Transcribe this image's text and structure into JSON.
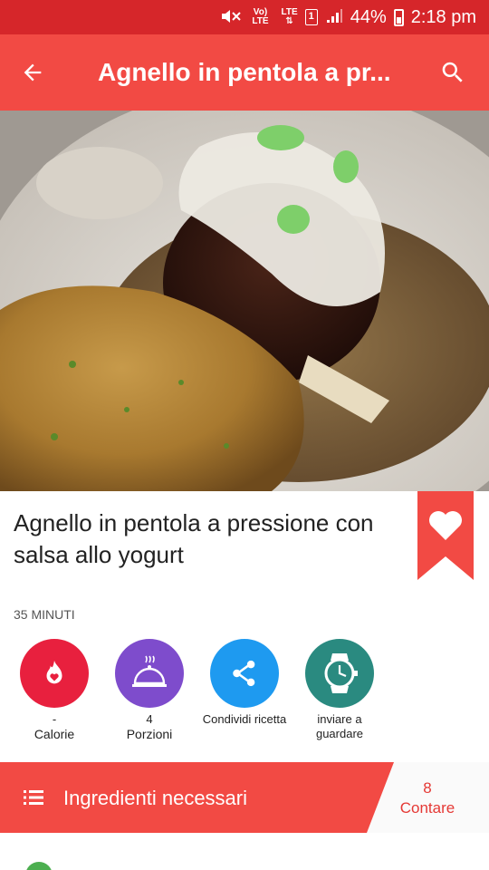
{
  "status_bar": {
    "volte": "Vo)",
    "lte_small": "LTE",
    "lte": "LTE",
    "sim": "1",
    "battery_text": "44%",
    "time": "2:18 pm"
  },
  "app_bar": {
    "title": "Agnello in pentola a pr...",
    "back_icon": "arrow-back-icon",
    "search_icon": "search-icon"
  },
  "recipe": {
    "title": "Agnello in pentola a pressione con salsa allo yogurt",
    "time": "35 MINUTI"
  },
  "actions": [
    {
      "value": "-",
      "label": "Calorie",
      "icon": "flame-heart-icon",
      "color": "#e8203e"
    },
    {
      "value": "4",
      "label": "Porzioni",
      "icon": "serving-dish-icon",
      "color": "#7e4ccc"
    },
    {
      "value": "",
      "label": "Condividi ricetta",
      "icon": "share-icon",
      "color": "#1e9af0"
    },
    {
      "value": "",
      "label": "inviare a guardare",
      "icon": "watch-icon",
      "color": "#2a8a80"
    }
  ],
  "ingredients_bar": {
    "label": "Ingredienti necessari",
    "count": "8",
    "count_label": "Contare"
  },
  "colors": {
    "status_bar": "#d6262a",
    "accent": "#f24a44"
  }
}
